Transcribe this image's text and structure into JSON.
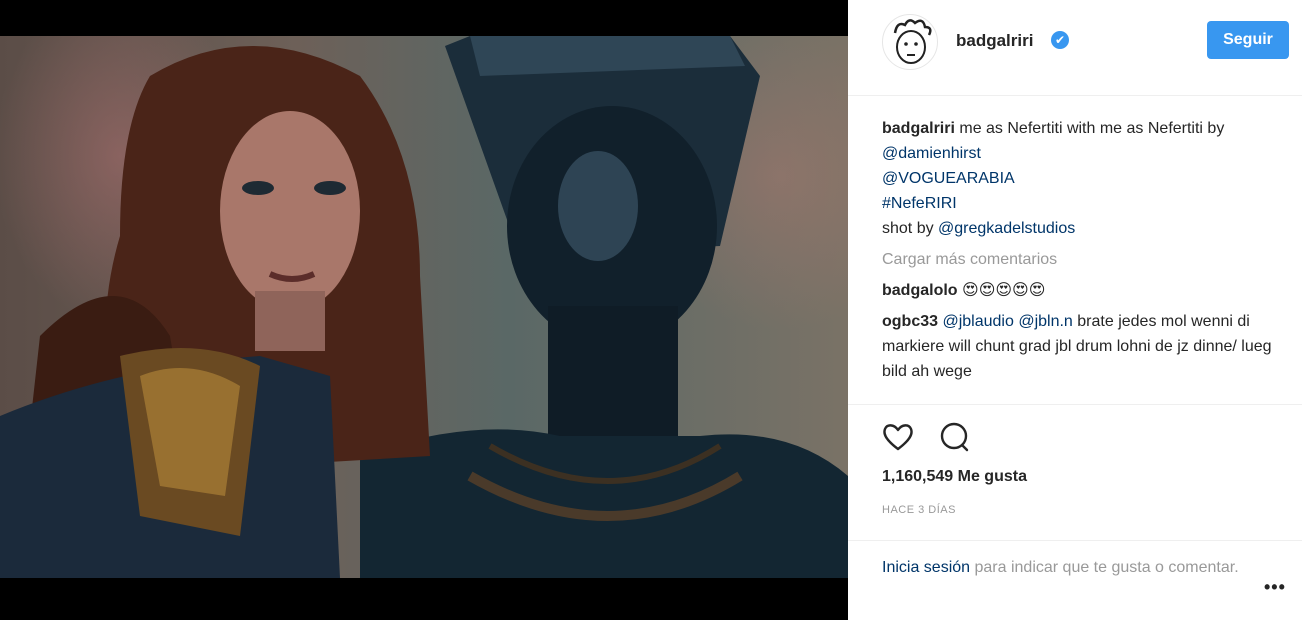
{
  "post": {
    "image_alt": "Rihanna beside a dark Nefertiti bust"
  },
  "header": {
    "username": "badgalriri",
    "verified_mark": "✔",
    "follow_label": "Seguir"
  },
  "caption": {
    "user": "badgalriri",
    "text_1": "me as Nefertiti with me as Nefertiti by ",
    "mention_1": "@damienhirst",
    "mention_2": "@VOGUEARABIA",
    "hashtag": "#NefeRIRI",
    "text_2": "shot by ",
    "mention_3": "@gregkadelstudios"
  },
  "load_more": "Cargar más comentarios",
  "comments": [
    {
      "user": "badgalolo",
      "text": "😍😍😍😍😍"
    },
    {
      "user": "ogbc33",
      "mention_1": "@jblaudio",
      "mention_2": "@jbln.n",
      "text": "brate jedes mol wenni di markiere will chunt grad jbl drum lohni de jz dinne/ lueg bild ah wege"
    }
  ],
  "actions": {
    "like_icon": "heart-icon",
    "comment_icon": "comment-icon"
  },
  "likes": "1,160,549 Me gusta",
  "timestamp": "HACE 3 DÍAS",
  "footer": {
    "login_link": "Inicia sesión",
    "login_text": " para indicar que te gusta o comentar.",
    "more": "•••"
  },
  "colors": {
    "accent": "#3897f0",
    "link": "#003569",
    "muted": "#999999"
  }
}
